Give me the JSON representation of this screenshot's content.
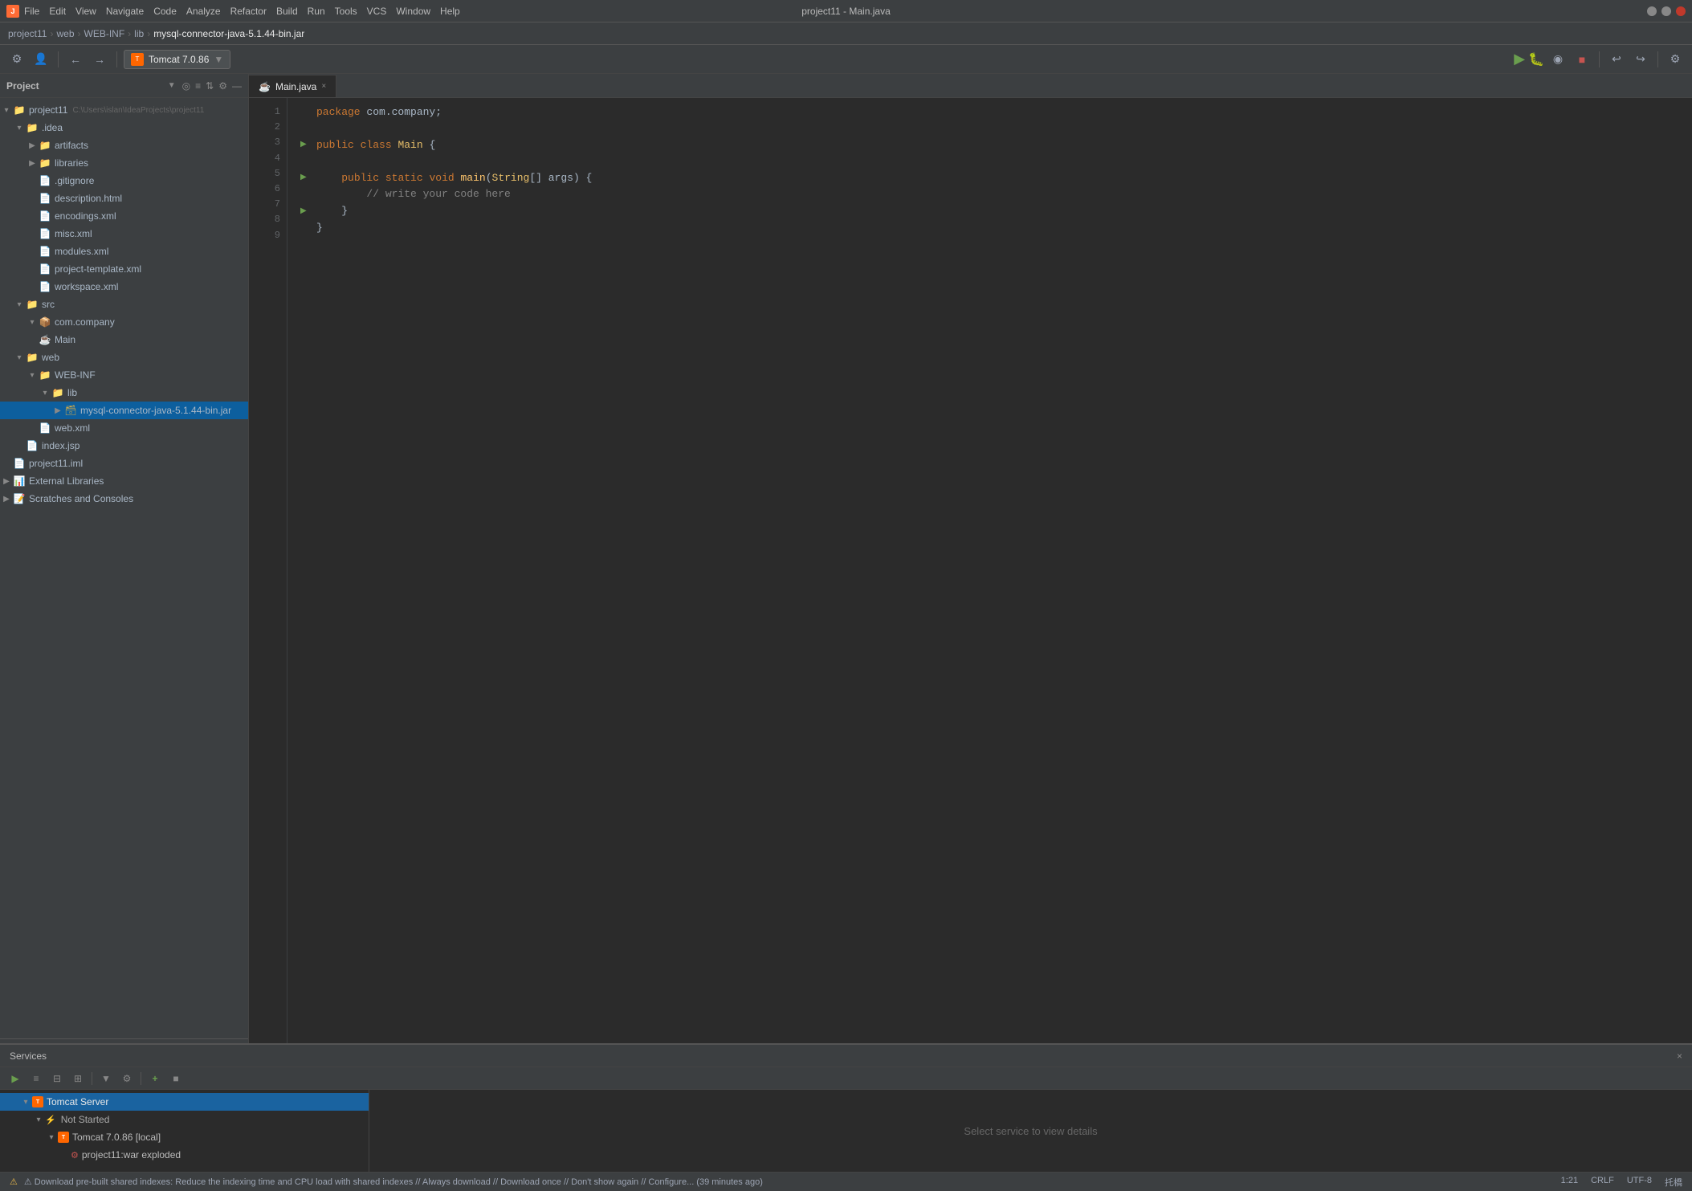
{
  "titlebar": {
    "app_icon": "J",
    "menus": [
      "File",
      "Edit",
      "View",
      "Navigate",
      "Code",
      "Analyze",
      "Refactor",
      "Build",
      "Run",
      "Tools",
      "VCS",
      "Window",
      "Help"
    ],
    "title": "project11 - Main.java",
    "minimize": "_",
    "maximize": "□",
    "close": "×"
  },
  "pathbar": {
    "parts": [
      "project11",
      "web",
      "WEB-INF",
      "lib",
      "mysql-connector-java-5.1.44-bin.jar"
    ]
  },
  "toolbar": {
    "tomcat_label": "Tomcat 7.0.86",
    "tomcat_icon": "T"
  },
  "sidebar": {
    "header_label": "Project",
    "tree": [
      {
        "id": "project11",
        "label": "project11",
        "indent": 0,
        "type": "project",
        "expanded": true,
        "path": "C:\\Users\\islan\\IdeaProjects\\project11"
      },
      {
        "id": "idea",
        "label": ".idea",
        "indent": 1,
        "type": "folder_config",
        "expanded": true
      },
      {
        "id": "artifacts",
        "label": "artifacts",
        "indent": 2,
        "type": "folder"
      },
      {
        "id": "libraries",
        "label": "libraries",
        "indent": 2,
        "type": "folder"
      },
      {
        "id": "gitignore",
        "label": ".gitignore",
        "indent": 2,
        "type": "file"
      },
      {
        "id": "description",
        "label": "description.html",
        "indent": 2,
        "type": "html"
      },
      {
        "id": "encodings",
        "label": "encodings.xml",
        "indent": 2,
        "type": "xml"
      },
      {
        "id": "misc",
        "label": "misc.xml",
        "indent": 2,
        "type": "xml"
      },
      {
        "id": "modules",
        "label": "modules.xml",
        "indent": 2,
        "type": "xml"
      },
      {
        "id": "project_template",
        "label": "project-template.xml",
        "indent": 2,
        "type": "xml"
      },
      {
        "id": "workspace",
        "label": "workspace.xml",
        "indent": 2,
        "type": "xml"
      },
      {
        "id": "src",
        "label": "src",
        "indent": 1,
        "type": "folder_src",
        "expanded": true
      },
      {
        "id": "com_company",
        "label": "com.company",
        "indent": 2,
        "type": "package",
        "expanded": true
      },
      {
        "id": "main_class",
        "label": "Main",
        "indent": 3,
        "type": "java"
      },
      {
        "id": "web",
        "label": "web",
        "indent": 1,
        "type": "folder_web",
        "expanded": true
      },
      {
        "id": "webinf",
        "label": "WEB-INF",
        "indent": 2,
        "type": "folder",
        "expanded": true
      },
      {
        "id": "lib",
        "label": "lib",
        "indent": 3,
        "type": "folder",
        "expanded": true
      },
      {
        "id": "mysql_jar",
        "label": "mysql-connector-java-5.1.44-bin.jar",
        "indent": 4,
        "type": "jar",
        "selected": true
      },
      {
        "id": "web_xml",
        "label": "web.xml",
        "indent": 3,
        "type": "xml"
      },
      {
        "id": "index_jsp",
        "label": "index.jsp",
        "indent": 2,
        "type": "jsp"
      },
      {
        "id": "project11_iml",
        "label": "project11.iml",
        "indent": 1,
        "type": "iml"
      },
      {
        "id": "external_libs",
        "label": "External Libraries",
        "indent": 0,
        "type": "ext_lib"
      },
      {
        "id": "scratches",
        "label": "Scratches and Consoles",
        "indent": 0,
        "type": "scratches"
      }
    ]
  },
  "editor": {
    "tab_label": "Main.java",
    "tab_icon": "☕",
    "code_lines": [
      {
        "num": 1,
        "run": false,
        "tokens": [
          {
            "t": "package",
            "c": "kw-package"
          },
          {
            "t": " com.company;",
            "c": "kw-normal"
          }
        ]
      },
      {
        "num": 2,
        "run": false,
        "tokens": []
      },
      {
        "num": 3,
        "run": true,
        "tokens": [
          {
            "t": "public",
            "c": "kw-keyword"
          },
          {
            "t": " ",
            "c": "kw-normal"
          },
          {
            "t": "class",
            "c": "kw-keyword"
          },
          {
            "t": " ",
            "c": "kw-normal"
          },
          {
            "t": "Main",
            "c": "kw-class-name"
          },
          {
            "t": " {",
            "c": "kw-normal"
          }
        ]
      },
      {
        "num": 4,
        "run": false,
        "tokens": []
      },
      {
        "num": 5,
        "run": true,
        "tokens": [
          {
            "t": "    ",
            "c": "kw-normal"
          },
          {
            "t": "public",
            "c": "kw-keyword"
          },
          {
            "t": " ",
            "c": "kw-normal"
          },
          {
            "t": "static",
            "c": "kw-keyword"
          },
          {
            "t": " ",
            "c": "kw-normal"
          },
          {
            "t": "void",
            "c": "kw-keyword"
          },
          {
            "t": " ",
            "c": "kw-normal"
          },
          {
            "t": "main",
            "c": "kw-method"
          },
          {
            "t": "(",
            "c": "kw-paren"
          },
          {
            "t": "String",
            "c": "kw-class-name"
          },
          {
            "t": "[] args) {",
            "c": "kw-normal"
          }
        ]
      },
      {
        "num": 6,
        "run": false,
        "tokens": [
          {
            "t": "        ",
            "c": "kw-normal"
          },
          {
            "t": "// write your code here",
            "c": "kw-comment"
          }
        ]
      },
      {
        "num": 7,
        "run": true,
        "tokens": [
          {
            "t": "    }",
            "c": "kw-normal"
          }
        ]
      },
      {
        "num": 8,
        "run": false,
        "tokens": [
          {
            "t": "}",
            "c": "kw-normal"
          }
        ]
      },
      {
        "num": 9,
        "run": false,
        "tokens": []
      }
    ]
  },
  "bottom_panel": {
    "title": "Services",
    "select_service_msg": "Select service to view details",
    "services": [
      {
        "id": "tomcat_server",
        "label": "Tomcat Server",
        "indent": 1,
        "type": "tomcat",
        "expanded": true,
        "selected": false,
        "highlighted": true
      },
      {
        "id": "not_started",
        "label": "Not Started",
        "indent": 2,
        "type": "status",
        "expanded": true
      },
      {
        "id": "tomcat_7",
        "label": "Tomcat 7.0.86 [local]",
        "indent": 3,
        "type": "tomcat_instance",
        "expanded": true
      },
      {
        "id": "project11_war",
        "label": "project11:war exploded",
        "indent": 4,
        "type": "war"
      }
    ]
  },
  "statusbar": {
    "message": "⚠ Download pre-built shared indexes: Reduce the indexing time and CPU load with shared indexes // Always download // Download once // Don't show again // Configure... (39 minutes ago)",
    "position": "1:21",
    "line_sep": "CRLF",
    "encoding": "UTF-8",
    "lang": "托橋"
  }
}
